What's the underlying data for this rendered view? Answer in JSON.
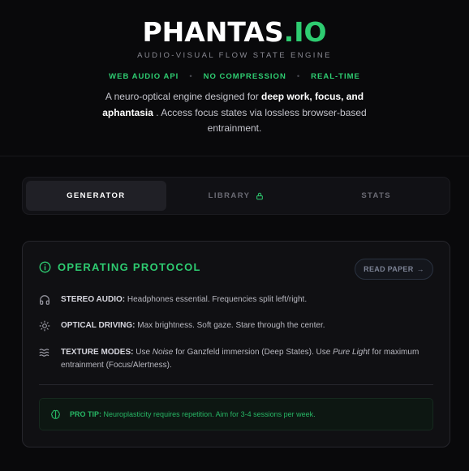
{
  "header": {
    "logo_main": "PHANTAS",
    "logo_accent": ".IO",
    "subtitle": "AUDIO-VISUAL FLOW STATE ENGINE",
    "tags": [
      "WEB AUDIO API",
      "NO COMPRESSION",
      "REAL-TIME"
    ],
    "separator": "•",
    "description": {
      "pre": "A neuro-optical engine designed for ",
      "bold": "deep work, focus, and aphantasia",
      "post": " . Access focus states via lossless browser-based entrainment."
    }
  },
  "tabs": [
    {
      "label": "GENERATOR",
      "active": true
    },
    {
      "label": "LIBRARY",
      "active": false,
      "icon": "lock-icon"
    },
    {
      "label": "STATS",
      "active": false
    }
  ],
  "protocol": {
    "title": "OPERATING PROTOCOL",
    "title_icon": "info-icon",
    "read_button": "READ PAPER",
    "read_button_arrow": "→",
    "items": [
      {
        "icon": "headphones-icon",
        "label": "STEREO AUDIO:",
        "text": "Headphones essential. Frequencies split left/right."
      },
      {
        "icon": "sun-icon",
        "label": "OPTICAL DRIVING:",
        "text": "Max brightness. Soft gaze. Stare through the center."
      },
      {
        "icon": "waves-icon",
        "label": "TEXTURE MODES:",
        "t1": "Use ",
        "em1": "Noise",
        "t2": " for Ganzfeld immersion (Deep States). Use ",
        "em2": "Pure Light",
        "t3": " for maximum entrainment (Focus/Alertness)."
      }
    ],
    "pro_tip": {
      "icon": "brain-icon",
      "label": "PRO TIP:",
      "text": "Neuroplasticity requires repetition. Aim for 3-4 sessions per week."
    }
  },
  "colors": {
    "accent": "#2ecc71",
    "background": "#09090b",
    "card": "#101013"
  }
}
